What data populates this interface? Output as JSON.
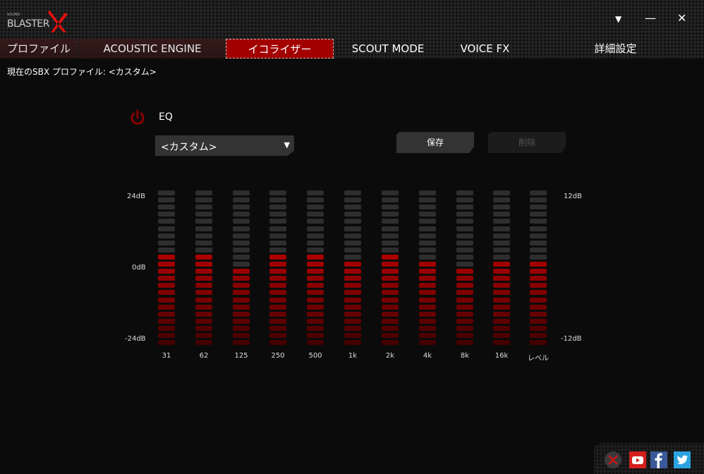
{
  "app": {
    "logo_text": "SOUND BLASTER X",
    "window_controls": {
      "menu": "▼",
      "minimize": "—",
      "close": "✕"
    }
  },
  "tabs": [
    {
      "label": "プロファイル",
      "active": false
    },
    {
      "label": "ACOUSTIC ENGINE",
      "active": false
    },
    {
      "label": "イコライザー",
      "active": true
    },
    {
      "label": "SCOUT MODE",
      "active": false
    },
    {
      "label": "VOICE FX",
      "active": false
    },
    {
      "label": "詳細設定",
      "active": false
    }
  ],
  "profile_line": "現在のSBX プロファイル: <カスタム>",
  "eq": {
    "label": "EQ",
    "power_icon": "power-icon",
    "power_color": "#8a0000",
    "preset": "<カスタム>",
    "save_label": "保存",
    "delete_label": "削除"
  },
  "colors": {
    "accent": "#a30000",
    "segment_off": "#2e2e2e"
  },
  "chart_data": {
    "type": "bar",
    "categories": [
      "31",
      "62",
      "125",
      "250",
      "500",
      "1k",
      "2k",
      "4k",
      "8k",
      "16k",
      "レベル"
    ],
    "values": [
      3,
      3,
      0,
      2.5,
      2.5,
      1.5,
      2.5,
      1.5,
      0,
      1.5,
      1.5
    ],
    "left_axis": {
      "ticks": [
        "24dB",
        "0dB",
        "-24dB"
      ],
      "range": [
        -24,
        24
      ]
    },
    "right_axis": {
      "ticks": [
        "12dB",
        "-12dB"
      ],
      "range": [
        -12,
        12
      ]
    },
    "units": "dB (right axis)"
  },
  "social": [
    {
      "name": "creative-icon"
    },
    {
      "name": "youtube-icon"
    },
    {
      "name": "facebook-icon"
    },
    {
      "name": "twitter-icon"
    }
  ]
}
